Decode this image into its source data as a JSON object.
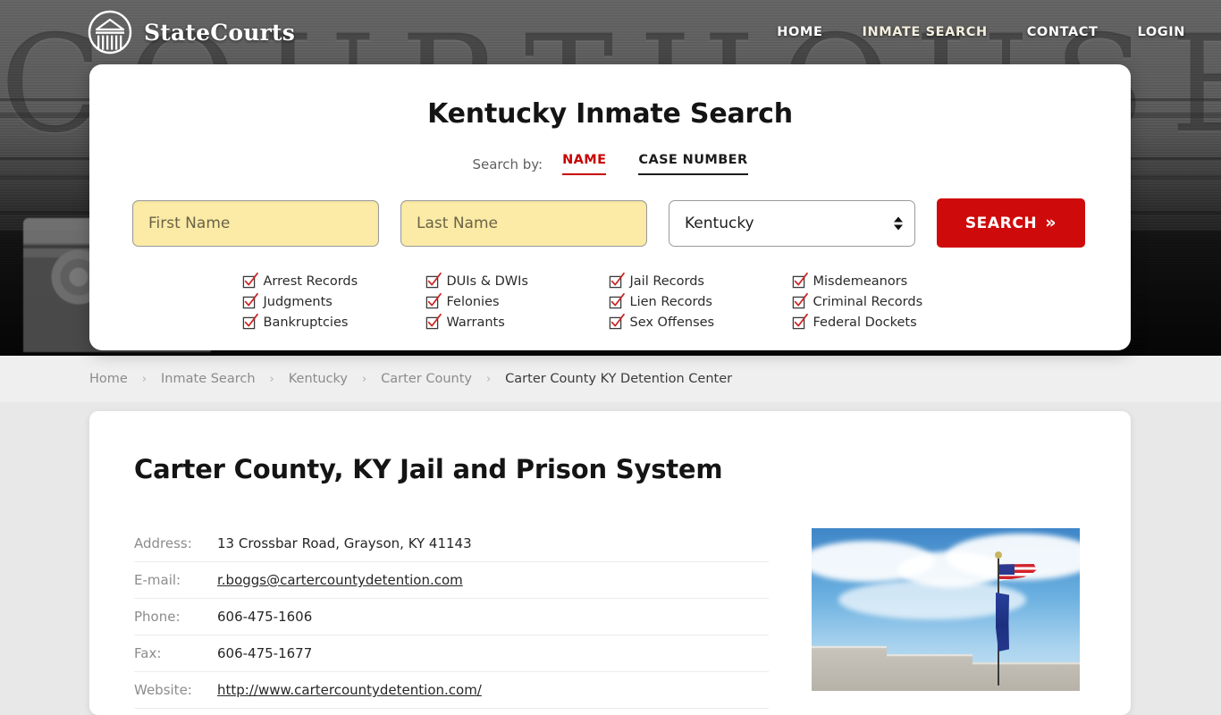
{
  "header": {
    "brand_name": "StateCourts",
    "logo_icon": "courthouse-circle-icon",
    "nav": [
      {
        "label": "HOME",
        "active": false
      },
      {
        "label": "INMATE SEARCH",
        "active": true
      },
      {
        "label": "CONTACT",
        "active": false
      },
      {
        "label": "LOGIN",
        "active": false
      }
    ]
  },
  "hero": {
    "background_word": "COURTHOUSE",
    "background_style": "grayscale-courthouse-photo"
  },
  "search_panel": {
    "title": "Kentucky Inmate Search",
    "search_by_label": "Search by:",
    "tabs": [
      {
        "label": "NAME",
        "active": true,
        "color": "#c80000"
      },
      {
        "label": "CASE NUMBER",
        "active": false,
        "color": "#1c1c1c"
      }
    ],
    "first_name": {
      "value": "",
      "placeholder": "First Name"
    },
    "last_name": {
      "value": "",
      "placeholder": "Last Name"
    },
    "state_select": {
      "value": "Kentucky"
    },
    "search_button": {
      "label": "SEARCH",
      "icon": "double-chevron-right",
      "color": "#cf0a0a"
    },
    "record_types": [
      "Arrest Records",
      "DUIs & DWIs",
      "Jail Records",
      "Misdemeanors",
      "Judgments",
      "Felonies",
      "Lien Records",
      "Criminal Records",
      "Bankruptcies",
      "Warrants",
      "Sex Offenses",
      "Federal Dockets"
    ],
    "checkbox_color": "#cc2222"
  },
  "breadcrumb": {
    "separator": "›",
    "items": [
      {
        "label": "Home",
        "current": false
      },
      {
        "label": "Inmate Search",
        "current": false
      },
      {
        "label": "Kentucky",
        "current": false
      },
      {
        "label": "Carter County",
        "current": false
      },
      {
        "label": "Carter County KY Detention Center",
        "current": true
      }
    ]
  },
  "main": {
    "page_title": "Carter County, KY Jail and Prison System",
    "details": [
      {
        "label": "Address:",
        "value": "13 Crossbar Road, Grayson, KY 41143",
        "link": false
      },
      {
        "label": "E-mail:",
        "value": "r.boggs@cartercountydetention.com",
        "link": true
      },
      {
        "label": "Phone:",
        "value": "606-475-1606",
        "link": false
      },
      {
        "label": "Fax:",
        "value": "606-475-1677",
        "link": false
      },
      {
        "label": "Website:",
        "value": "http://www.cartercountydetention.com/",
        "link": true
      }
    ],
    "photo": {
      "name": "detention-center-photo",
      "description": "Detention center building with flagpole flying US and state flags against blue sky"
    }
  }
}
